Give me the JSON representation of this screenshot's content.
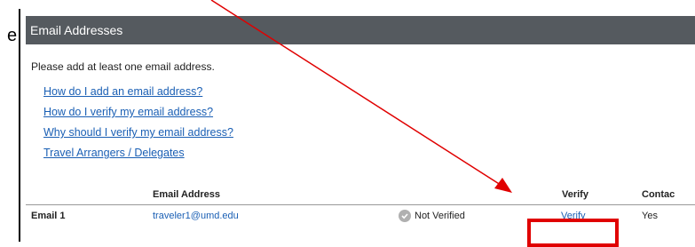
{
  "edge_text": "e",
  "panel": {
    "title": "Email Addresses",
    "intro": "Please add at least one email address.",
    "links": [
      "How do I add an email address?",
      "How do I verify my email address?",
      "Why should I verify my email address?",
      "Travel Arrangers / Delegates"
    ]
  },
  "table": {
    "headers": {
      "email": "Email Address",
      "verify": "Verify",
      "contact": "Contac"
    },
    "rows": [
      {
        "label": "Email 1",
        "email": "traveler1@umd.edu",
        "status": "Not Verified",
        "verify": "Verify",
        "contact": "Yes"
      }
    ]
  },
  "colors": {
    "header_bg": "#555a5f",
    "link": "#1a5fb4",
    "highlight": "#e00000"
  },
  "icons": {
    "status": "check-circle-icon"
  }
}
